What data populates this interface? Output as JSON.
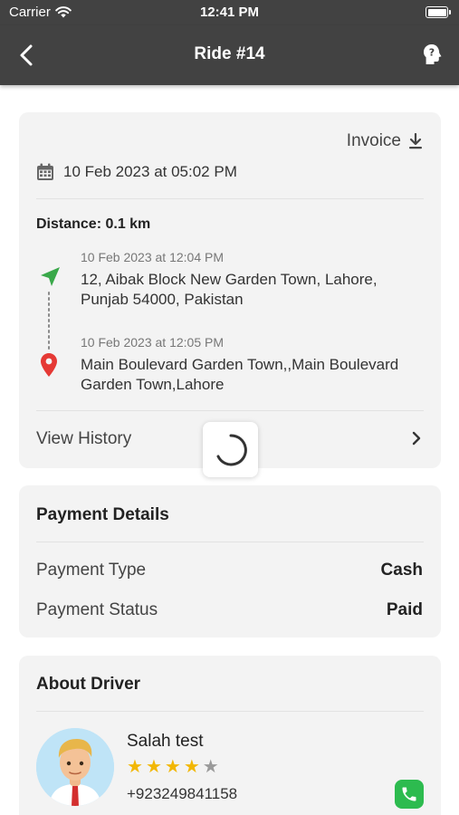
{
  "status_bar": {
    "carrier": "Carrier",
    "time": "12:41 PM"
  },
  "nav": {
    "title": "Ride #14"
  },
  "ride": {
    "invoice_label": "Invoice",
    "datetime": "10 Feb 2023 at 05:02 PM",
    "distance": "Distance: 0.1 km",
    "pickup": {
      "time": "10 Feb 2023 at 12:04 PM",
      "address": "12, Aibak Block New Garden Town, Lahore, Punjab 54000, Pakistan"
    },
    "dropoff": {
      "time": "10 Feb 2023 at 12:05 PM",
      "address": "Main Boulevard Garden Town,,Main Boulevard Garden Town,Lahore"
    },
    "view_history_label": "View History"
  },
  "payment": {
    "title": "Payment Details",
    "rows": [
      {
        "label": "Payment Type",
        "value": "Cash"
      },
      {
        "label": "Payment Status",
        "value": "Paid"
      }
    ]
  },
  "driver": {
    "title": "About Driver",
    "name": "Salah test",
    "rating": 4,
    "rating_max": 5,
    "phone": "+923249841158"
  },
  "icons": {
    "back": "chevron-left-icon",
    "help": "head-question-icon",
    "download": "download-icon",
    "calendar": "calendar-icon",
    "pickup": "navigation-arrow-icon",
    "dropoff": "map-pin-icon",
    "chevron": "chevron-right-icon",
    "call": "phone-icon"
  },
  "colors": {
    "header_bg": "#424242",
    "card_bg": "#f3f3f3",
    "pickup_green": "#3aa84a",
    "dropoff_red": "#e53935",
    "star": "#f2b705",
    "call_green": "#2dbb4f"
  }
}
